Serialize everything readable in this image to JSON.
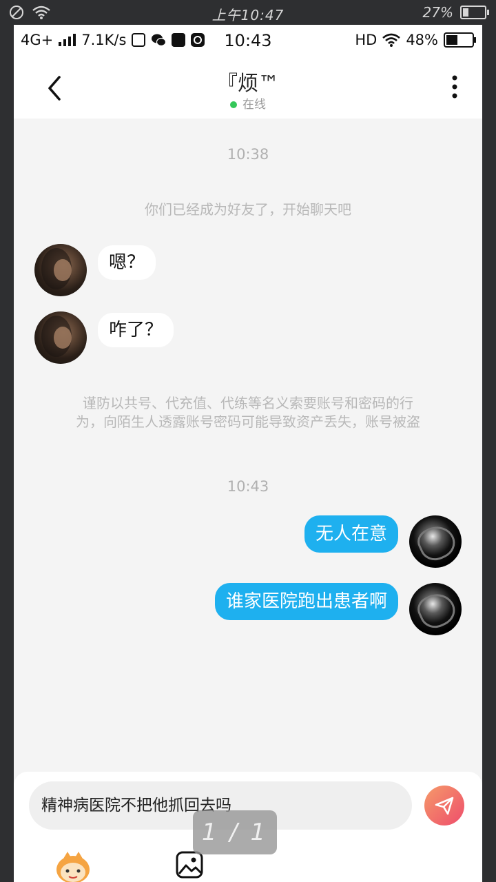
{
  "outer_status": {
    "time": "上午10:47",
    "battery": "27%",
    "battery_level": 0.27,
    "icons": [
      "no-disturb-icon",
      "wifi-icon",
      "battery-icon"
    ]
  },
  "status_bar": {
    "network": "4G+",
    "speed": "7.1K/s",
    "time": "10:43",
    "hd": "HD",
    "battery": "48%",
    "battery_level": 0.48
  },
  "header": {
    "title": "『烦™",
    "status": "在线",
    "status_color": "#34c759"
  },
  "chat": {
    "timestamp1": "10:38",
    "system_friend": "你们已经成为好友了，开始聊天吧",
    "messages_in": [
      {
        "text": "嗯？"
      },
      {
        "text": "咋了？"
      }
    ],
    "warning_line1": "谨防以共号、代充值、代练等名义索要账号和密码的行",
    "warning_line2": "为，向陌生人透露账号密码可能导致资产丢失，账号被盗",
    "timestamp2": "10:43",
    "messages_out": [
      {
        "text": "无人在意"
      },
      {
        "text": "谁家医院跑出患者啊"
      }
    ]
  },
  "composer": {
    "input_value": "精神病医院不把他抓回去吗",
    "send_color": "#ee4d6b"
  },
  "viewer": {
    "pager": "1 / 1"
  }
}
